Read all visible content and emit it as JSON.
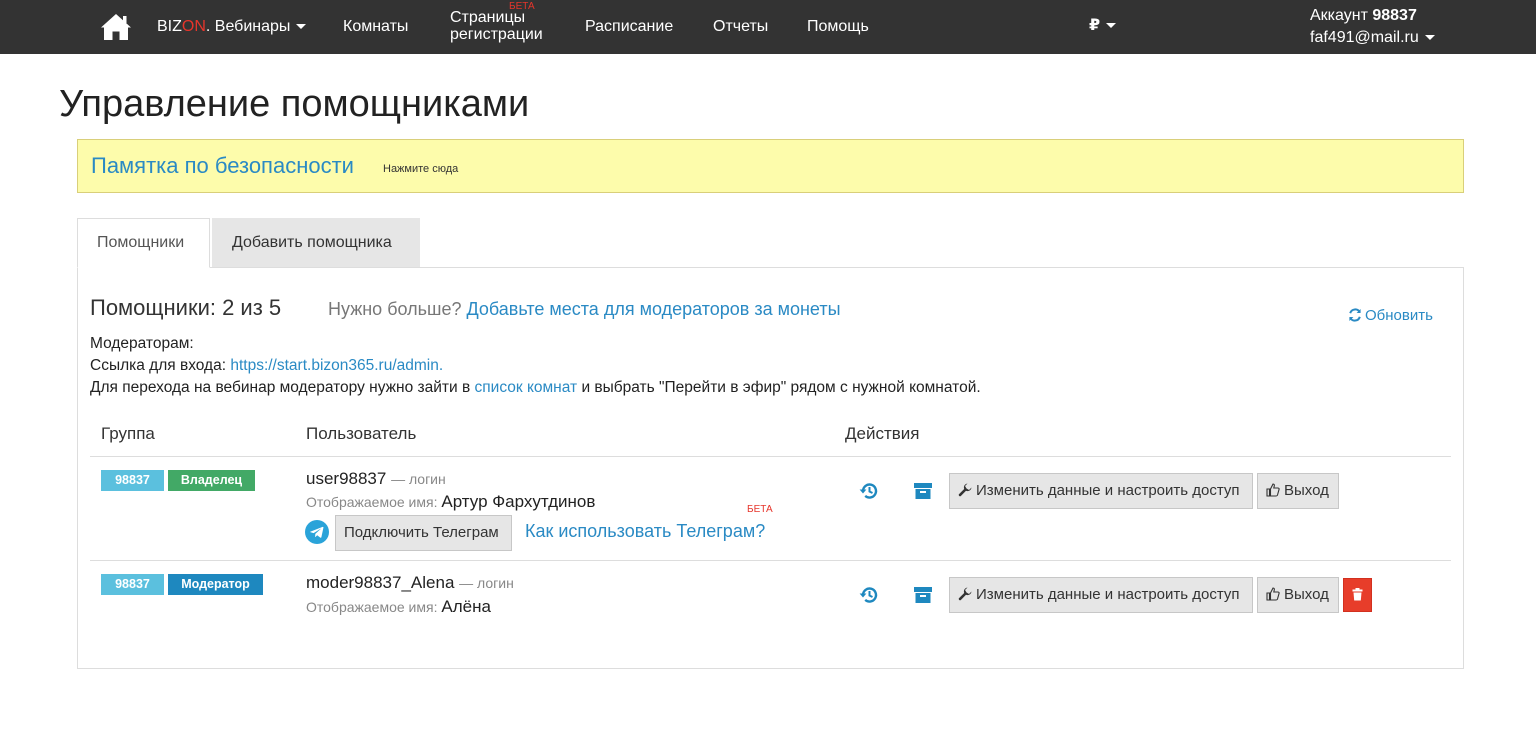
{
  "nav": {
    "brand_a": "BIZ",
    "brand_b": "ON",
    "brand_c": ". Вебинары",
    "rooms": "Комнаты",
    "pages_l1": "Страницы",
    "pages_l2": "регистрации",
    "pages_badge": "БЕТА",
    "schedule": "Расписание",
    "reports": "Отчеты",
    "help": "Помощь",
    "currency": "₽",
    "account_label": "Аккаунт",
    "account_id": "98837",
    "email": "faf491@mail.ru"
  },
  "page": {
    "title": "Управление помощниками",
    "alert_link": "Памятка по безопасности",
    "alert_hint": "Нажмите сюда"
  },
  "tabs": {
    "helpers": "Помощники",
    "add": "Добавить помощника"
  },
  "panel": {
    "counts": "Помощники: 2 из 5",
    "need_more": "Нужно больше?",
    "need_more_link": "Добавьте места для модераторов за монеты",
    "refresh": "Обновить",
    "mods_label": "Модераторам:",
    "login_link_label": "Ссылка для входа:",
    "login_link": "https://start.bizon365.ru/admin.",
    "goto_a": "Для перехода на вебинар модератору нужно зайти в",
    "goto_link": "список комнат",
    "goto_b": "и выбрать \"Перейти в эфир\" рядом с нужной комнатой."
  },
  "table": {
    "headers": {
      "group": "Группа",
      "user": "Пользователь",
      "actions": "Действия"
    },
    "rows": [
      {
        "group_id": "98837",
        "role": "Владелец",
        "login": "user98837",
        "login_suffix": "— логин",
        "display_label": "Отображаемое имя:",
        "display_name": "Артур Фархутдинов",
        "telegram_button": "Подключить Телеграм",
        "telegram_link": "Как использовать Телеграм?",
        "telegram_badge": "БЕТА",
        "edit_button": "Изменить данные и настроить доступ",
        "exit_button": "Выход"
      },
      {
        "group_id": "98837",
        "role": "Модератор",
        "login": "moder98837_Alena",
        "login_suffix": "— логин",
        "display_label": "Отображаемое имя:",
        "display_name": "Алёна",
        "edit_button": "Изменить данные и настроить доступ",
        "exit_button": "Выход"
      }
    ]
  },
  "colors": {
    "navbar": "#333333",
    "link": "#2a8ac4",
    "alert_bg": "#fdfcab",
    "label_id": "#5bc0de",
    "label_owner": "#42a966",
    "label_moderator": "#1e88bf",
    "danger": "#e73d2a",
    "telegram": "#2aa3d9"
  },
  "icons": [
    "home-icon",
    "refresh-icon",
    "telegram-icon",
    "history-icon",
    "archive-icon",
    "wrench-icon",
    "thumbs-up-icon",
    "trash-icon"
  ]
}
